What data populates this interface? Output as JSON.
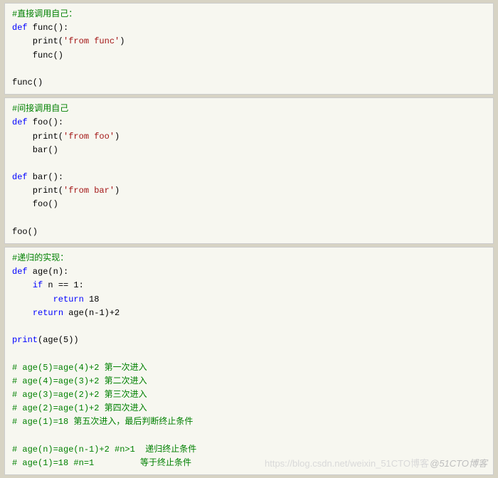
{
  "block1": {
    "l1": "#直接调用自己：",
    "l2a": "def",
    "l2b": " func():",
    "l3a": "    print(",
    "l3b": "'from func'",
    "l3c": ")",
    "l4": "    func()",
    "l5": "",
    "l6": "func()"
  },
  "block2": {
    "l1": "#间接调用自己",
    "l2a": "def",
    "l2b": " foo():",
    "l3a": "    print(",
    "l3b": "'from foo'",
    "l3c": ")",
    "l4": "    bar()",
    "l5": "",
    "l6a": "def",
    "l6b": " bar():",
    "l7a": "    print(",
    "l7b": "'from bar'",
    "l7c": ")",
    "l8": "    foo()",
    "l9": "",
    "l10": "foo()"
  },
  "block3": {
    "l1": "#递归的实现：",
    "l2a": "def",
    "l2b": " age(n):",
    "l3a": "    ",
    "l3b": "if",
    "l3c": " n == 1:",
    "l4a": "        ",
    "l4b": "return",
    "l4c": " 18",
    "l5a": "    ",
    "l5b": "return",
    "l5c": " age(n-1)+2",
    "l6": "",
    "l7a": "print",
    "l7b": "(age(5))",
    "l8": "",
    "l9": "# age(5)=age(4)+2 第一次进入",
    "l10": "# age(4)=age(3)+2 第二次进入",
    "l11": "# age(3)=age(2)+2 第三次进入",
    "l12": "# age(2)=age(1)+2 第四次进入",
    "l13": "# age(1)=18 第五次进入，最后判断终止条件",
    "l14": "",
    "l15": "# age(n)=age(n-1)+2 #n>1  递归终止条件",
    "l16": "# age(1)=18 #n=1         等于终止条件"
  },
  "watermark1": "https://blog.csdn.net/weixin_51CTO博客",
  "watermark2": "@51CTO博客"
}
